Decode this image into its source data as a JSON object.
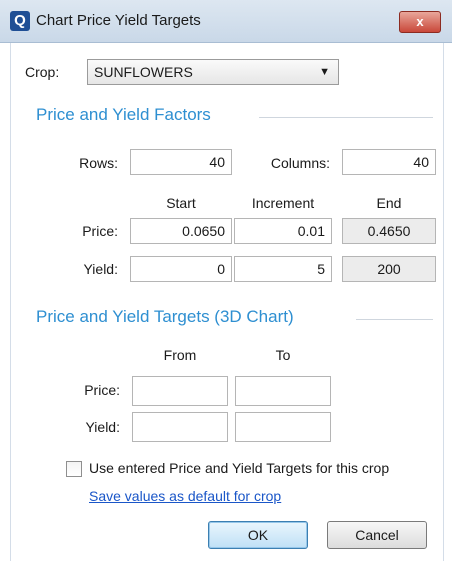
{
  "window": {
    "title": "Chart Price Yield Targets",
    "icon_letter": "Q",
    "close_symbol": "x"
  },
  "crop": {
    "label": "Crop:",
    "value": "SUNFLOWERS",
    "arrow": "▼"
  },
  "factors": {
    "heading": "Price and Yield Factors",
    "rows_label": "Rows:",
    "rows_value": "40",
    "columns_label": "Columns:",
    "columns_value": "40",
    "col_start": "Start",
    "col_increment": "Increment",
    "col_end": "End",
    "price_label": "Price:",
    "price_start": "0.0650",
    "price_increment": "0.01",
    "price_end": "0.4650",
    "yield_label": "Yield:",
    "yield_start": "0",
    "yield_increment": "5",
    "yield_end": "200"
  },
  "targets": {
    "heading": "Price and Yield Targets (3D Chart)",
    "col_from": "From",
    "col_to": "To",
    "price_label": "Price:",
    "price_from": "",
    "price_to": "",
    "yield_label": "Yield:",
    "yield_from": "",
    "yield_to": ""
  },
  "use_targets": {
    "label": "Use entered Price and Yield Targets for this crop",
    "checked": false
  },
  "save_default_link": "Save values as default for crop",
  "buttons": {
    "ok": "OK",
    "cancel": "Cancel"
  },
  "colors": {
    "section_heading": "#2e8fd1",
    "link": "#1a56c8",
    "close_button": "#c9483a"
  }
}
